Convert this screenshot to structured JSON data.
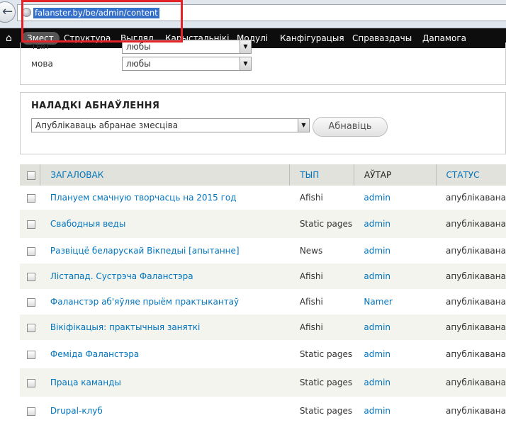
{
  "browser": {
    "url": "falanster.by/be/admin/content"
  },
  "toolbar": {
    "items": [
      "Змест",
      "Структура",
      "Выгляд",
      "Карыстальнікі",
      "Модулі",
      "Канфігурацыя",
      "Справаздачы",
      "Дапамога"
    ]
  },
  "filters": {
    "row1_label": "тып",
    "row1_value": "любы",
    "row2_label": "мова",
    "row2_value": "любы"
  },
  "update": {
    "title": "НАЛАДКІ АБНАЎЛЕННЯ",
    "select_value": "Апублікаваць абранае змесціва",
    "button": "Абнавіць"
  },
  "table": {
    "headers": {
      "title": "ЗАГАЛОВАК",
      "type": "ТЫП",
      "author": "АЎТАР",
      "status": "СТАТУС"
    },
    "rows": [
      {
        "title": "Плануем смачную творчасць на 2015 год",
        "type": "Afishi",
        "author": "admin",
        "status": "апублікавана"
      },
      {
        "title": "Свабодныя веды",
        "type": "Static pages",
        "author": "admin",
        "status": "апублікавана"
      },
      {
        "title": "Развіццё беларускай Вікпедыі [апытанне]",
        "type": "News",
        "author": "admin",
        "status": "апублікавана"
      },
      {
        "title": "Лістапад. Сустрэча Фаланстэра",
        "type": "Afishi",
        "author": "admin",
        "status": "апублікавана"
      },
      {
        "title": "Фаланстэр аб'яўляе прыём практыкантаў",
        "type": "Afishi",
        "author": "Namer",
        "status": "апублікавана"
      },
      {
        "title": "Вікіфікацыя: практычныя заняткі",
        "type": "Afishi",
        "author": "admin",
        "status": "апублікавана"
      },
      {
        "title": "Феміда Фаланстэра",
        "type": "Static pages",
        "author": "admin",
        "status": "апублікавана"
      },
      {
        "title": "Праца каманды",
        "type": "Static pages",
        "author": "admin",
        "status": "апублікавана"
      },
      {
        "title": "Drupal-клуб",
        "type": "Static pages",
        "author": "admin",
        "status": "апублікавана"
      }
    ]
  }
}
